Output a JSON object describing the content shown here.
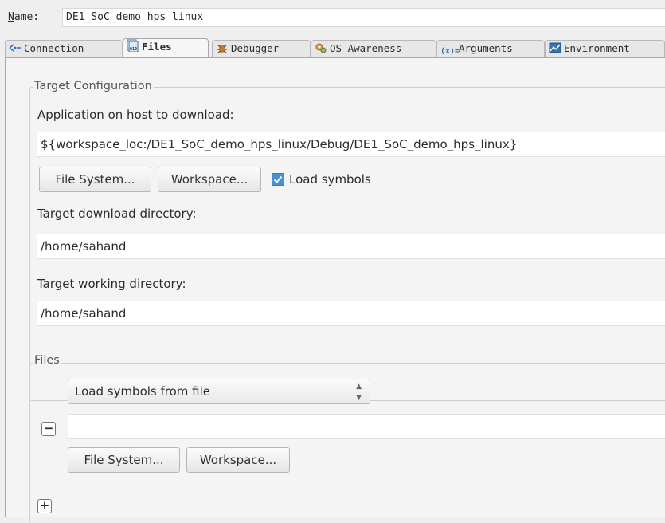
{
  "name_row": {
    "label": "Name:",
    "value": "DE1_SoC_demo_hps_linux"
  },
  "tabs": [
    {
      "label": "Connection",
      "icon": "connection-icon"
    },
    {
      "label": "Files",
      "icon": "files-icon",
      "active": true
    },
    {
      "label": "Debugger",
      "icon": "bug-icon"
    },
    {
      "label": "OS Awareness",
      "icon": "gear-icon"
    },
    {
      "label": "Arguments",
      "icon": "arguments-icon"
    },
    {
      "label": "Environment",
      "icon": "environment-icon"
    }
  ],
  "target_config": {
    "legend": "Target Configuration",
    "app_label": "Application on host to download:",
    "app_value": "${workspace_loc:/DE1_SoC_demo_hps_linux/Debug/DE1_SoC_demo_hps_linux}",
    "file_system_button": "File System...",
    "workspace_button": "Workspace...",
    "load_symbols_label": "Load symbols",
    "load_symbols_checked": true,
    "download_dir_label": "Target download directory:",
    "download_dir_value": "/home/sahand",
    "working_dir_label": "Target working directory:",
    "working_dir_value": "/home/sahand"
  },
  "files": {
    "legend": "Files",
    "combo_value": "Load symbols from file",
    "remove_label": "−",
    "file_value": "",
    "file_system_button": "File System...",
    "workspace_button": "Workspace...",
    "add_label": "+"
  },
  "colors": {
    "accent": "#4a90d9"
  }
}
